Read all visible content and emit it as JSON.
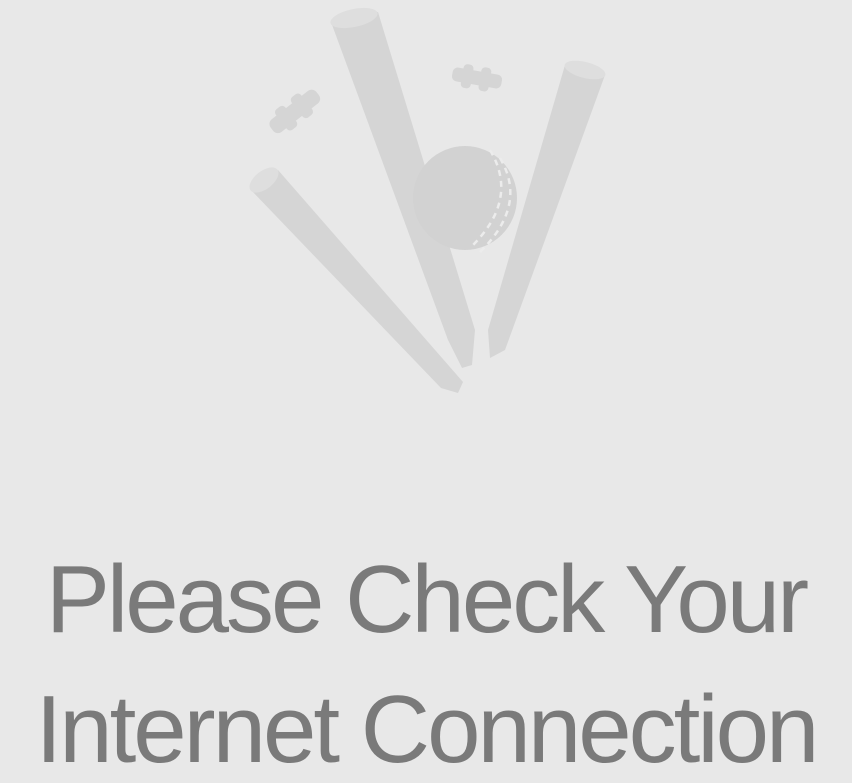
{
  "screen": {
    "illustration_icon": "broken-cricket-wicket-icon",
    "colors": {
      "background": "#e8e8e8",
      "illustration": "#d4d4d4",
      "text": "#7a7a7a"
    }
  },
  "message": {
    "line1": "Please Check Your",
    "line2": "Internet Connection"
  }
}
